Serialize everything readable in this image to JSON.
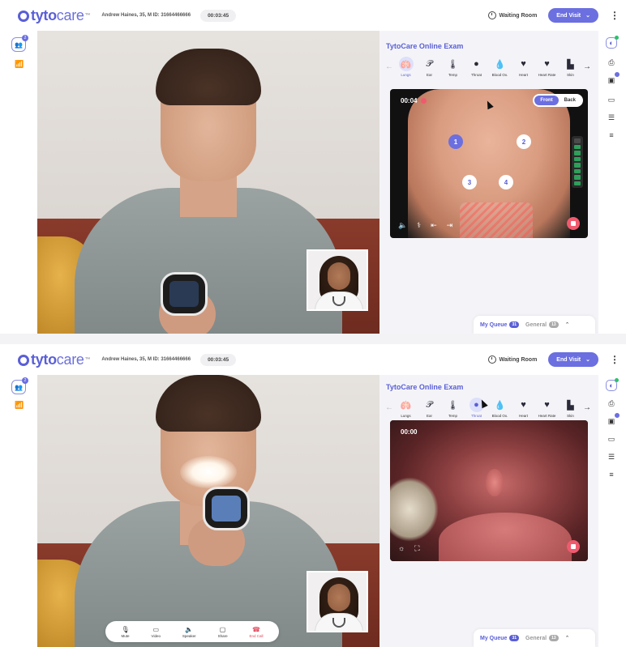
{
  "header": {
    "logo_tyto": "tyto",
    "logo_care": "care",
    "logo_tm": "™",
    "patient_info": "Andrew Haines, 35, M   ID: 31664466666",
    "call_timer": "00:03:45",
    "waiting_room": "Waiting Room",
    "end_visit": "End Visit",
    "end_visit_chevron": "⌄",
    "menu_icon": "⋮"
  },
  "left_rail": {
    "participants_badge": "2",
    "participants_icon": "people-icon",
    "network_icon": "wifi-icon"
  },
  "exam": {
    "title": "TytoCare Online Exam",
    "prev_arrow": "←",
    "next_arrow": "→",
    "items": [
      {
        "label": "Lungs",
        "glyph": "🫁"
      },
      {
        "label": "Ear",
        "glyph": "𝒫"
      },
      {
        "label": "Temp",
        "glyph": "🌡"
      },
      {
        "label": "Throat",
        "glyph": "●"
      },
      {
        "label": "Blood Ox.",
        "glyph": "💧"
      },
      {
        "label": "Heart",
        "glyph": "♥"
      },
      {
        "label": "Heart Rate",
        "glyph": "♥"
      },
      {
        "label": "Skin",
        "glyph": "▙"
      }
    ]
  },
  "top_frame": {
    "active_exam": "Lungs",
    "rec_time": "00:04",
    "toggle_front": "Front",
    "toggle_back": "Back",
    "points": [
      "1",
      "2",
      "3",
      "4"
    ],
    "selected_point": "1",
    "meter_level_fraction": 0.85,
    "controls": [
      "🔈",
      "⚕",
      "⇤",
      "⇥"
    ]
  },
  "bottom_frame": {
    "active_exam": "Throat",
    "rec_time": "00:00",
    "controls": [
      "☼",
      "⛶"
    ]
  },
  "queue": {
    "my_queue": "My Queue",
    "my_queue_count": "31",
    "general": "General",
    "general_count": "13",
    "chevron": "⌃"
  },
  "call_controls": [
    {
      "label": "Mute",
      "icon": "🎙"
    },
    {
      "label": "Video",
      "icon": "▭"
    },
    {
      "label": "Speaker",
      "icon": "🔈"
    },
    {
      "label": "Share",
      "icon": "▢"
    },
    {
      "label": "End Call",
      "icon": "☎"
    }
  ],
  "right_rail": {
    "icons": [
      "notes-icon",
      "printer-icon",
      "shared-files-icon",
      "id-card-icon",
      "checklist-icon",
      "summary-icon"
    ]
  },
  "colors": {
    "brand": "#5a5fd6",
    "accent_button": "#6b6fe0",
    "record_red": "#f05a6e",
    "meter_green": "#2e9e5a"
  }
}
